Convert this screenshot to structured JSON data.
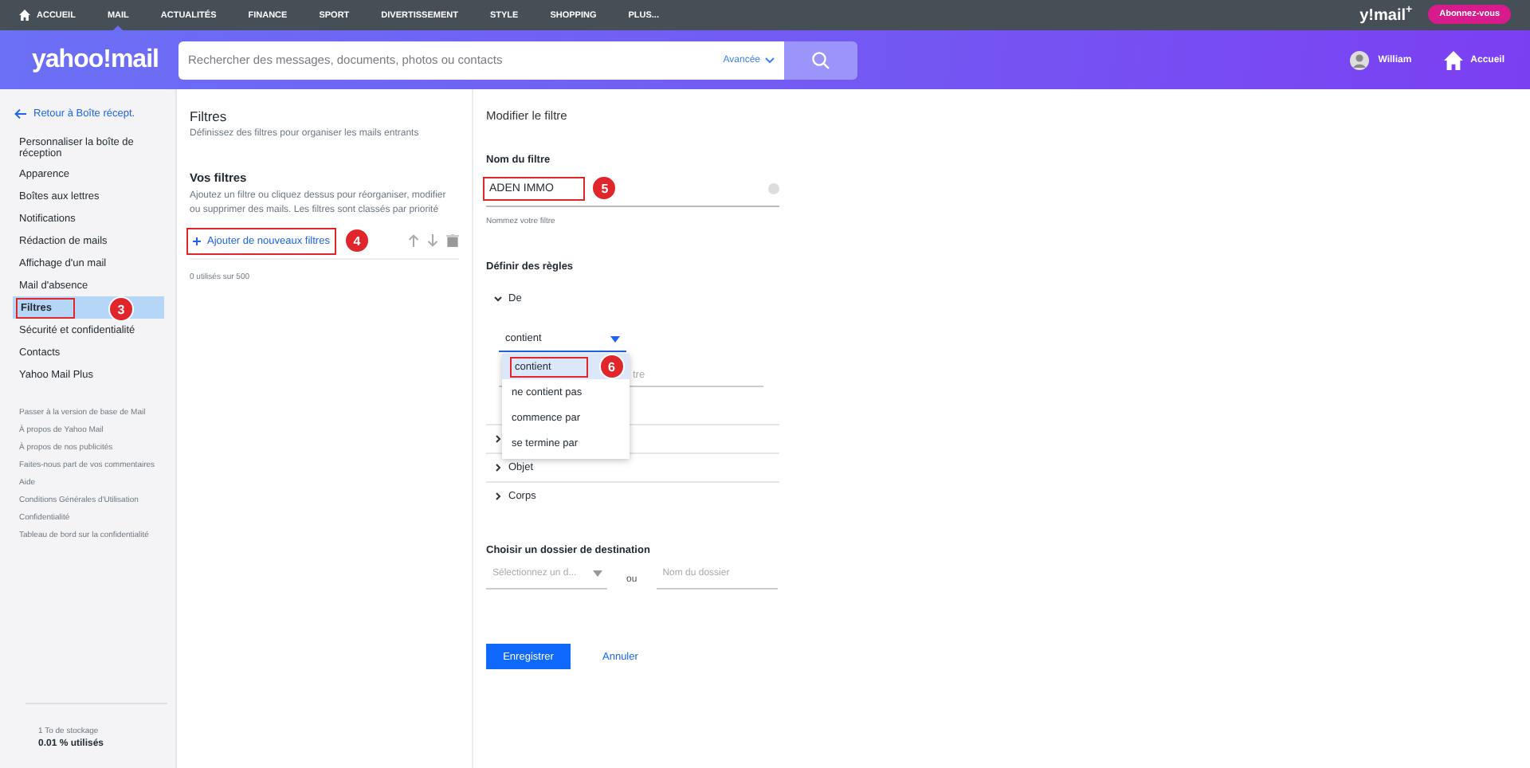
{
  "top_nav": {
    "items": [
      {
        "label": "ACCUEIL",
        "selected": false
      },
      {
        "label": "MAIL",
        "selected": true
      },
      {
        "label": "ACTUALITÉS",
        "selected": false
      },
      {
        "label": "FINANCE",
        "selected": false
      },
      {
        "label": "SPORT",
        "selected": false
      },
      {
        "label": "DIVERTISSEMENT",
        "selected": false
      },
      {
        "label": "STYLE",
        "selected": false
      },
      {
        "label": "SHOPPING",
        "selected": false
      },
      {
        "label": "PLUS...",
        "selected": false
      }
    ],
    "brand": "y!mail",
    "brand_sup": "+",
    "subscribe": "Abonnez-vous"
  },
  "header": {
    "logo": "yahoo!mail",
    "search": {
      "placeholder": "Rechercher des messages, documents, photos ou contacts",
      "advanced": "Avancée"
    },
    "user": "William",
    "home": "Accueil"
  },
  "sidebar": {
    "back": "Retour à Boîte récept.",
    "items": [
      {
        "label": "Personnaliser la boîte de réception",
        "selected": false
      },
      {
        "label": "Apparence",
        "selected": false
      },
      {
        "label": "Boîtes aux lettres",
        "selected": false
      },
      {
        "label": "Notifications",
        "selected": false
      },
      {
        "label": "Rédaction de mails",
        "selected": false
      },
      {
        "label": "Affichage d'un mail",
        "selected": false
      },
      {
        "label": "Mail d'absence",
        "selected": false
      },
      {
        "label": "Filtres",
        "selected": true,
        "callout": "3"
      },
      {
        "label": "Sécurité et confidentialité",
        "selected": false
      },
      {
        "label": "Contacts",
        "selected": false
      },
      {
        "label": "Yahoo Mail Plus",
        "selected": false
      }
    ],
    "links": [
      "Passer à la version de base de Mail",
      "À propos de Yahoo Mail",
      "À propos de nos publicités",
      "Faites-nous part de vos commentaires",
      "Aide",
      "Conditions Générales d'Utilisation",
      "Confidentialité",
      "Tableau de bord sur la confidentialité"
    ],
    "storage": {
      "label": "1 To de stockage",
      "used": "0.01 % utilisés"
    }
  },
  "filters_panel": {
    "title": "Filtres",
    "subtitle": "Définissez des filtres pour organiser les mails entrants",
    "section_title": "Vos filtres",
    "description": "Ajoutez un filtre ou cliquez dessus pour réorganiser, modifier ou supprimer des mails. Les filtres sont classés par priorité",
    "add_button": {
      "label": "Ajouter de nouveaux filtres",
      "callout": "4"
    },
    "count": "0 utilisés sur 500"
  },
  "edit_panel": {
    "title": "Modifier le filtre",
    "name_label": "Nom du filtre",
    "name_value": "ADEN IMMO",
    "name_callout": "5",
    "name_hint": "Nommez votre filtre",
    "rules_title": "Définir des règles",
    "rules": [
      {
        "label": "De",
        "expanded": true
      },
      {
        "expanded": false
      },
      {
        "label": "Objet",
        "expanded": false
      },
      {
        "label": "Corps",
        "expanded": false
      }
    ],
    "condition_select": {
      "value": "contient"
    },
    "condition_field": {
      "placeholder": "tre"
    },
    "condition_options": [
      {
        "label": "contient",
        "selected": true,
        "callout": "6"
      },
      {
        "label": "ne contient pas",
        "selected": false
      },
      {
        "label": "commence par",
        "selected": false
      },
      {
        "label": "se termine par",
        "selected": false
      }
    ],
    "destination_title": "Choisir un dossier de destination",
    "folder_select": {
      "placeholder": "Sélectionnez un d..."
    },
    "or": "ou",
    "folder_name": {
      "placeholder": "Nom du dossier"
    },
    "save": "Enregistrer",
    "cancel": "Annuler"
  }
}
